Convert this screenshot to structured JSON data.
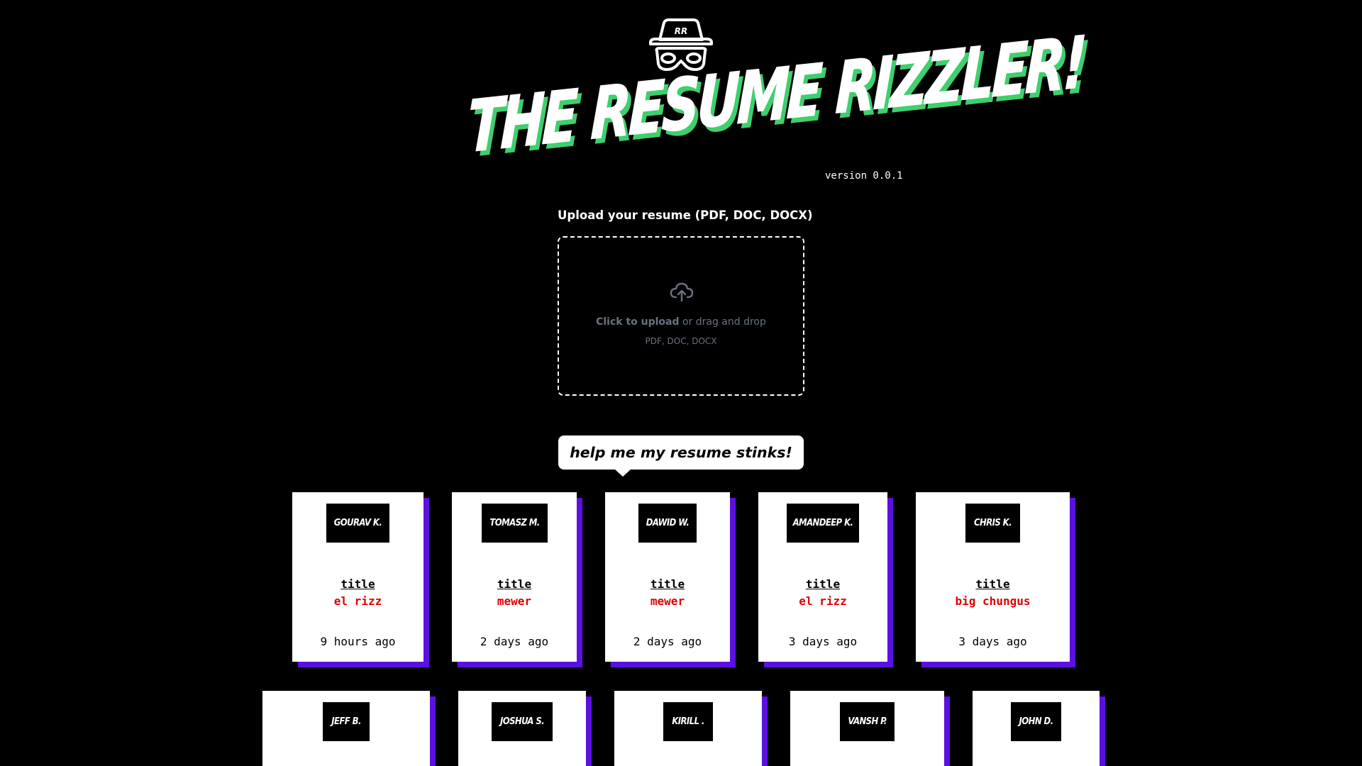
{
  "header": {
    "logo_initials": "RR",
    "title": "THE RESUME RIZZLER!",
    "version": "version 0.0.1"
  },
  "upload": {
    "label": "Upload your resume (PDF, DOC, DOCX)",
    "click_text": "Click to upload",
    "drag_text": " or drag and drop",
    "formats": "PDF, DOC, DOCX"
  },
  "bubble": {
    "text": "help me my resume stinks!"
  },
  "cards": [
    {
      "name": "GOURAV K.",
      "title_label": "title",
      "title": "el rizz",
      "time": "9 hours ago"
    },
    {
      "name": "TOMASZ M.",
      "title_label": "title",
      "title": "mewer",
      "time": "2 days ago"
    },
    {
      "name": "DAWID W.",
      "title_label": "title",
      "title": "mewer",
      "time": "2 days ago"
    },
    {
      "name": "AMANDEEP K.",
      "title_label": "title",
      "title": "el rizz",
      "time": "3 days ago"
    },
    {
      "name": "CHRIS K.",
      "title_label": "title",
      "title": "big chungus",
      "time": "3 days ago"
    },
    {
      "name": "JEFF B."
    },
    {
      "name": "JOSHUA S."
    },
    {
      "name": "KIRILL ."
    },
    {
      "name": "VANSH P."
    },
    {
      "name": "JOHN D."
    }
  ],
  "colors": {
    "background": "#000000",
    "title_green": "#3ecf6e",
    "card_shadow": "#5b0fe0",
    "rank_red": "#e00000",
    "muted_gray": "#6b7280"
  }
}
